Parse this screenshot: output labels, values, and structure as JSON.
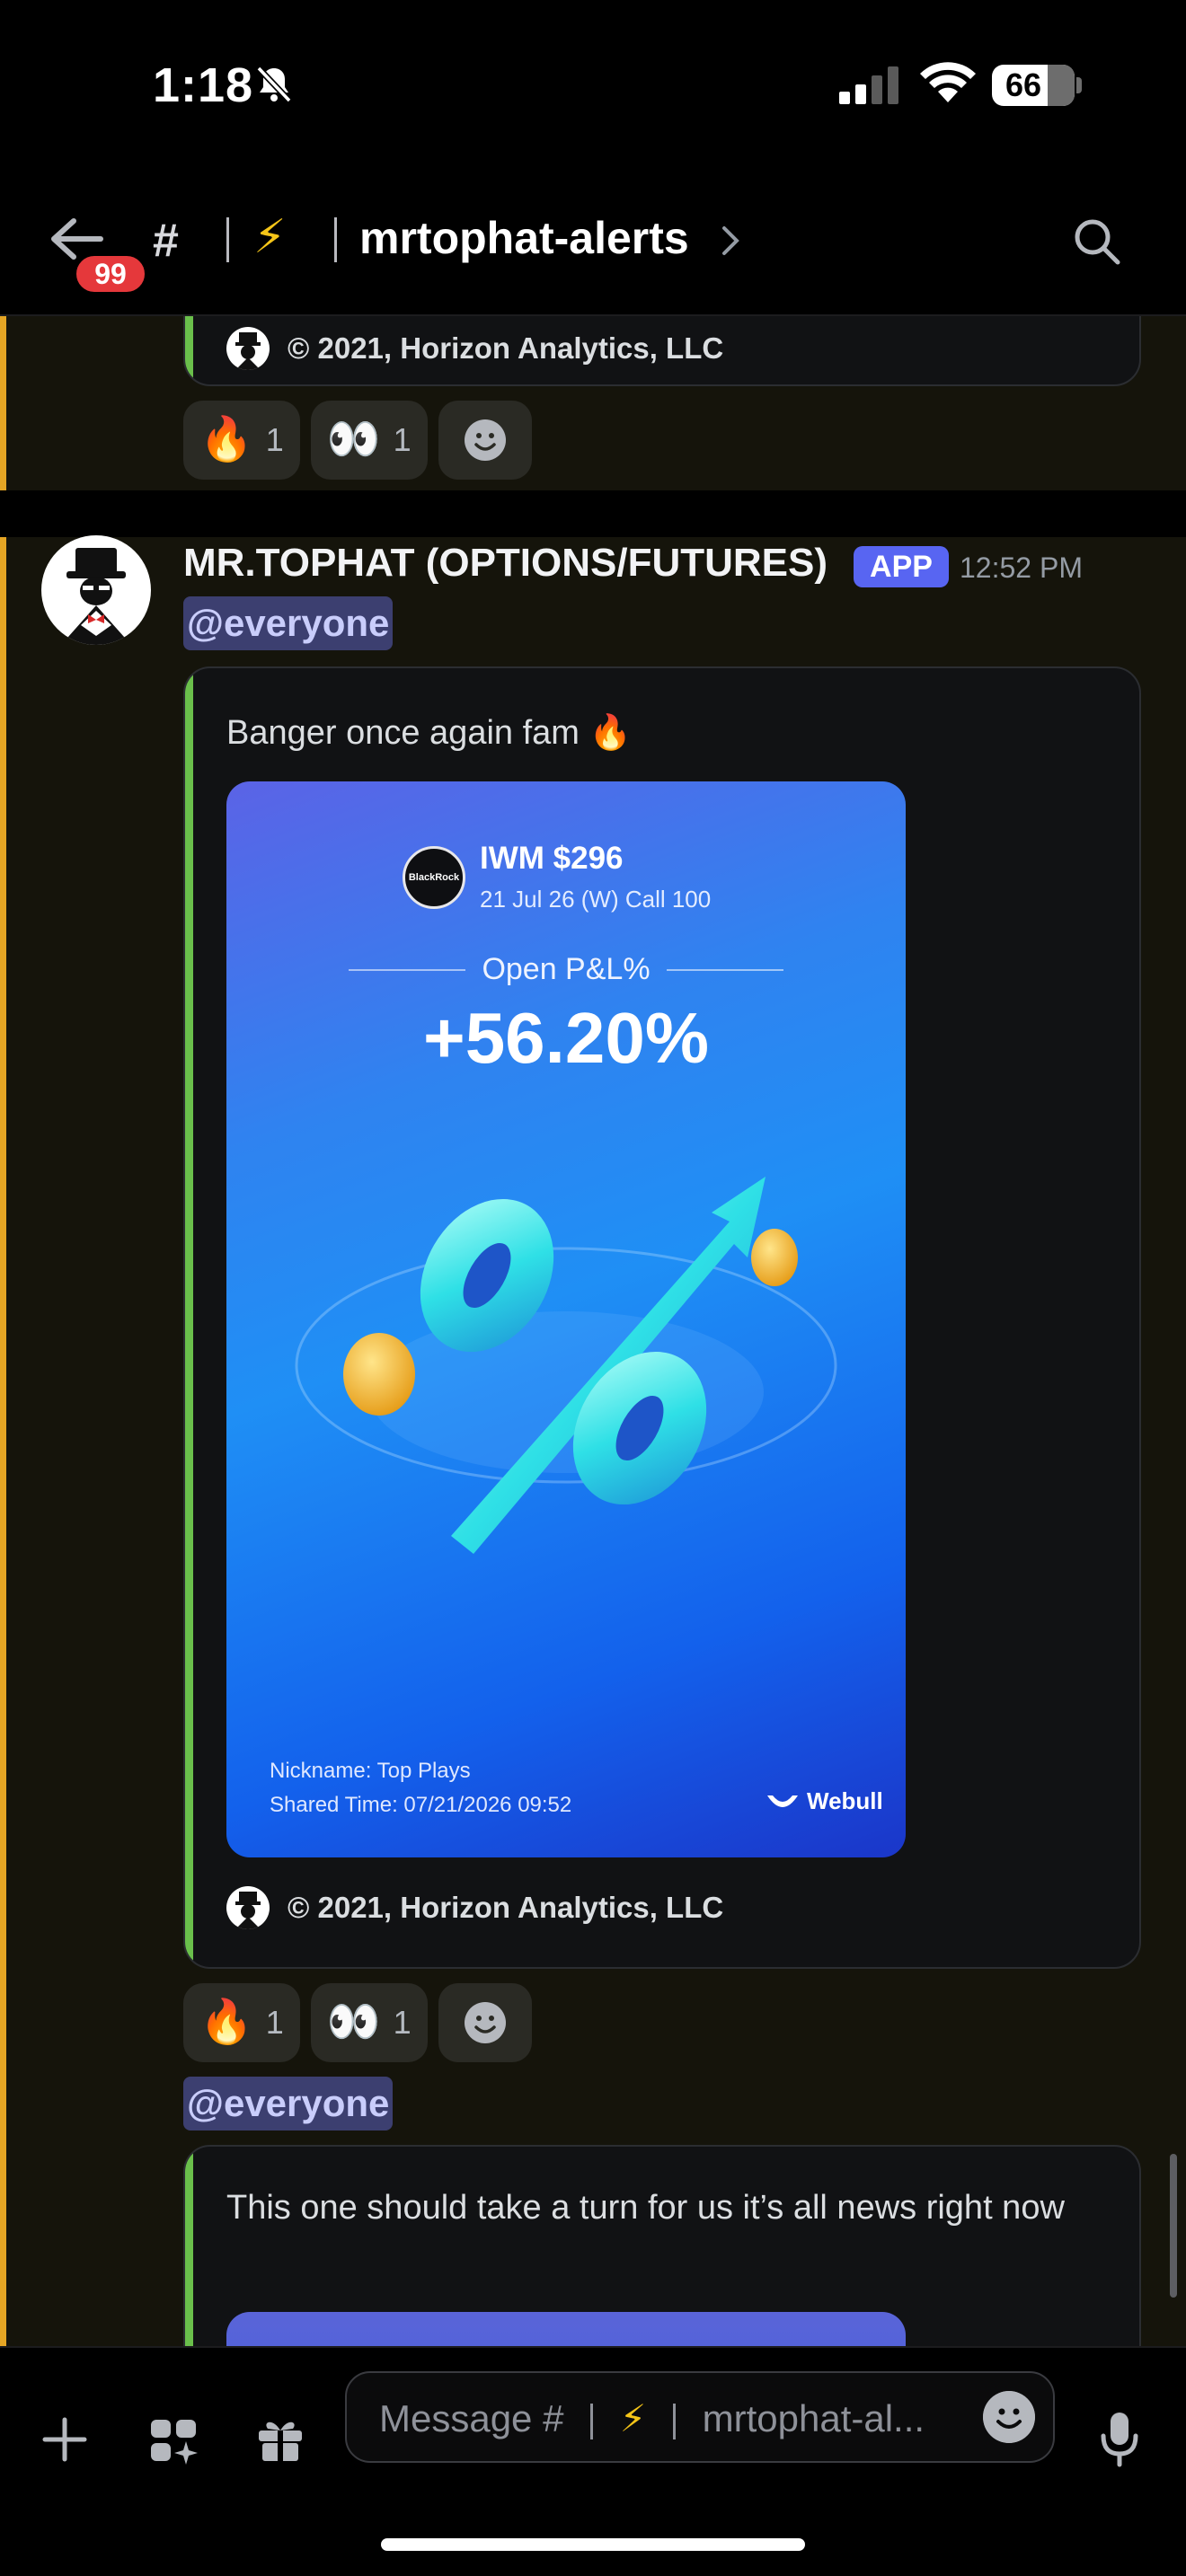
{
  "status_bar": {
    "time": "1:18",
    "battery": "66",
    "icons": [
      "bell-slash-icon",
      "cellular-signal-icon",
      "wifi-icon",
      "battery-icon"
    ]
  },
  "header": {
    "unread_badge": "99",
    "channel_prefix_icon": "hash-lock-icon",
    "channel_emoji": "⚡",
    "channel_name": "mrtophat-alerts",
    "icons": [
      "back-arrow-icon",
      "chevron-right-icon",
      "search-icon"
    ]
  },
  "previous_message": {
    "embed_footer": "© 2021, Horizon Analytics, LLC",
    "reactions": [
      {
        "emoji": "🔥",
        "count": "1"
      },
      {
        "emoji": "👀",
        "count": "1"
      }
    ]
  },
  "message": {
    "author": "MR.TOPHAT (OPTIONS/FUTURES)",
    "app_tag": "APP",
    "timestamp": "12:52 PM",
    "mention": "@everyone",
    "embed": {
      "description": "Banger once again fam 🔥",
      "card": {
        "logo_text": "BlackRock",
        "ticker": "IWM $296",
        "contract": "21 Jul 26 (W) Call 100",
        "pnl_label": "Open P&L%",
        "pnl_value": "+56.20%",
        "nickname": "Nickname: Top Plays",
        "shared_time": "Shared Time: 07/21/2026 09:52",
        "brand": "Webull"
      },
      "footer": "© 2021, Horizon Analytics, LLC"
    },
    "reactions": [
      {
        "emoji": "🔥",
        "count": "1"
      },
      {
        "emoji": "👀",
        "count": "1"
      }
    ]
  },
  "next_message": {
    "mention": "@everyone",
    "embed_description": "This one should take a turn for us it’s all news right now"
  },
  "composer": {
    "placeholder_prefix": "Message #",
    "placeholder_emoji": "⚡",
    "placeholder_channel": "mrtophat-al...",
    "icons": [
      "plus-icon",
      "apps-icon",
      "gift-icon",
      "emoji-icon",
      "microphone-icon"
    ]
  },
  "colors": {
    "background": "#15140b",
    "embed_accent": "#6abf4b",
    "gutter_highlight": "#e4a524",
    "app_tag": "#5865f2",
    "badge": "#e5383b"
  }
}
